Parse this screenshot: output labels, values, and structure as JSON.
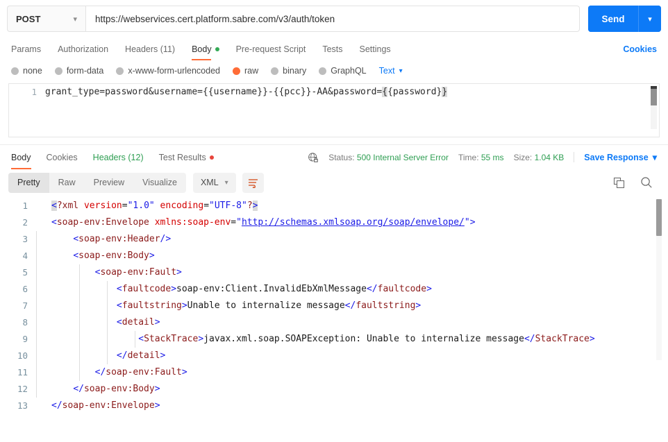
{
  "request": {
    "method": "POST",
    "url": "https://webservices.cert.platform.sabre.com/v3/auth/token",
    "send_label": "Send",
    "tabs": [
      {
        "label": "Params",
        "active": false
      },
      {
        "label": "Authorization",
        "active": false
      },
      {
        "label": "Headers (11)",
        "active": false
      },
      {
        "label": "Body",
        "active": true,
        "indicator": "green"
      },
      {
        "label": "Pre-request Script",
        "active": false
      },
      {
        "label": "Tests",
        "active": false
      },
      {
        "label": "Settings",
        "active": false
      }
    ],
    "cookies_label": "Cookies",
    "body_types": [
      {
        "label": "none",
        "selected": false
      },
      {
        "label": "form-data",
        "selected": false
      },
      {
        "label": "x-www-form-urlencoded",
        "selected": false
      },
      {
        "label": "raw",
        "selected": true
      },
      {
        "label": "binary",
        "selected": false
      },
      {
        "label": "GraphQL",
        "selected": false
      }
    ],
    "raw_format": "Text",
    "body_line_number": "1",
    "body_text_main": "grant_type=password&username={{username}}-{{pcc}}-AA&password=",
    "body_brace_open": "{",
    "body_text_var": "{password}",
    "body_brace_close": "}"
  },
  "response": {
    "tabs": [
      {
        "label": "Body",
        "active": true
      },
      {
        "label": "Cookies",
        "active": false
      },
      {
        "label": "Headers (12)",
        "active": false,
        "green": true
      },
      {
        "label": "Test Results",
        "active": false,
        "indicator": "red"
      }
    ],
    "status_label": "Status:",
    "status_value": "500 Internal Server Error",
    "time_label": "Time:",
    "time_value": "55 ms",
    "size_label": "Size:",
    "size_value": "1.04 KB",
    "save_response_label": "Save Response",
    "view_modes": [
      {
        "label": "Pretty",
        "active": true
      },
      {
        "label": "Raw",
        "active": false
      },
      {
        "label": "Preview",
        "active": false
      },
      {
        "label": "Visualize",
        "active": false
      }
    ],
    "format": "XML",
    "code": {
      "l1_num": "1",
      "l1_a": "<",
      "l1_b": "?xml ",
      "l1_c": "version",
      "l1_d": "=",
      "l1_e": "\"1.0\"",
      "l1_f": " encoding",
      "l1_g": "=",
      "l1_h": "\"UTF-8\"",
      "l1_i": "?",
      "l1_j": ">",
      "l2_num": "2",
      "l2_a": "<",
      "l2_b": "soap-env:Envelope",
      "l2_c": " xmlns:soap-env",
      "l2_d": "=",
      "l2_e": "\"",
      "l2_f": "http://schemas.xmlsoap.org/soap/envelope/",
      "l2_g": "\"",
      "l2_h": ">",
      "l3_num": "3",
      "l3_a": "<",
      "l3_b": "soap-env:Header",
      "l3_c": "/>",
      "l4_num": "4",
      "l4_a": "<",
      "l4_b": "soap-env:Body",
      "l4_c": ">",
      "l5_num": "5",
      "l5_a": "<",
      "l5_b": "soap-env:Fault",
      "l5_c": ">",
      "l6_num": "6",
      "l6_a": "<",
      "l6_b": "faultcode",
      "l6_c": ">",
      "l6_d": "soap-env:Client.InvalidEbXmlMessage",
      "l6_e": "</",
      "l6_f": "faultcode",
      "l6_g": ">",
      "l7_num": "7",
      "l7_a": "<",
      "l7_b": "faultstring",
      "l7_c": ">",
      "l7_d": "Unable to internalize message",
      "l7_e": "</",
      "l7_f": "faultstring",
      "l7_g": ">",
      "l8_num": "8",
      "l8_a": "<",
      "l8_b": "detail",
      "l8_c": ">",
      "l9_num": "9",
      "l9_a": "<",
      "l9_b": "StackTrace",
      "l9_c": ">",
      "l9_d": "javax.xml.soap.SOAPException: Unable to internalize message",
      "l9_e": "</",
      "l9_f": "StackTrace",
      "l9_g": ">",
      "l10_num": "10",
      "l10_a": "</",
      "l10_b": "detail",
      "l10_c": ">",
      "l11_num": "11",
      "l11_a": "</",
      "l11_b": "soap-env:Fault",
      "l11_c": ">",
      "l12_num": "12",
      "l12_a": "</",
      "l12_b": "soap-env:Body",
      "l12_c": ">",
      "l13_num": "13",
      "l13_a": "</",
      "l13_b": "soap-env:Envelope",
      "l13_c": ">"
    }
  },
  "colors": {
    "accent_blue": "#0d7af7",
    "accent_orange": "#ff6c37",
    "status_green": "#2e9e52",
    "error_red": "#e8453c"
  }
}
